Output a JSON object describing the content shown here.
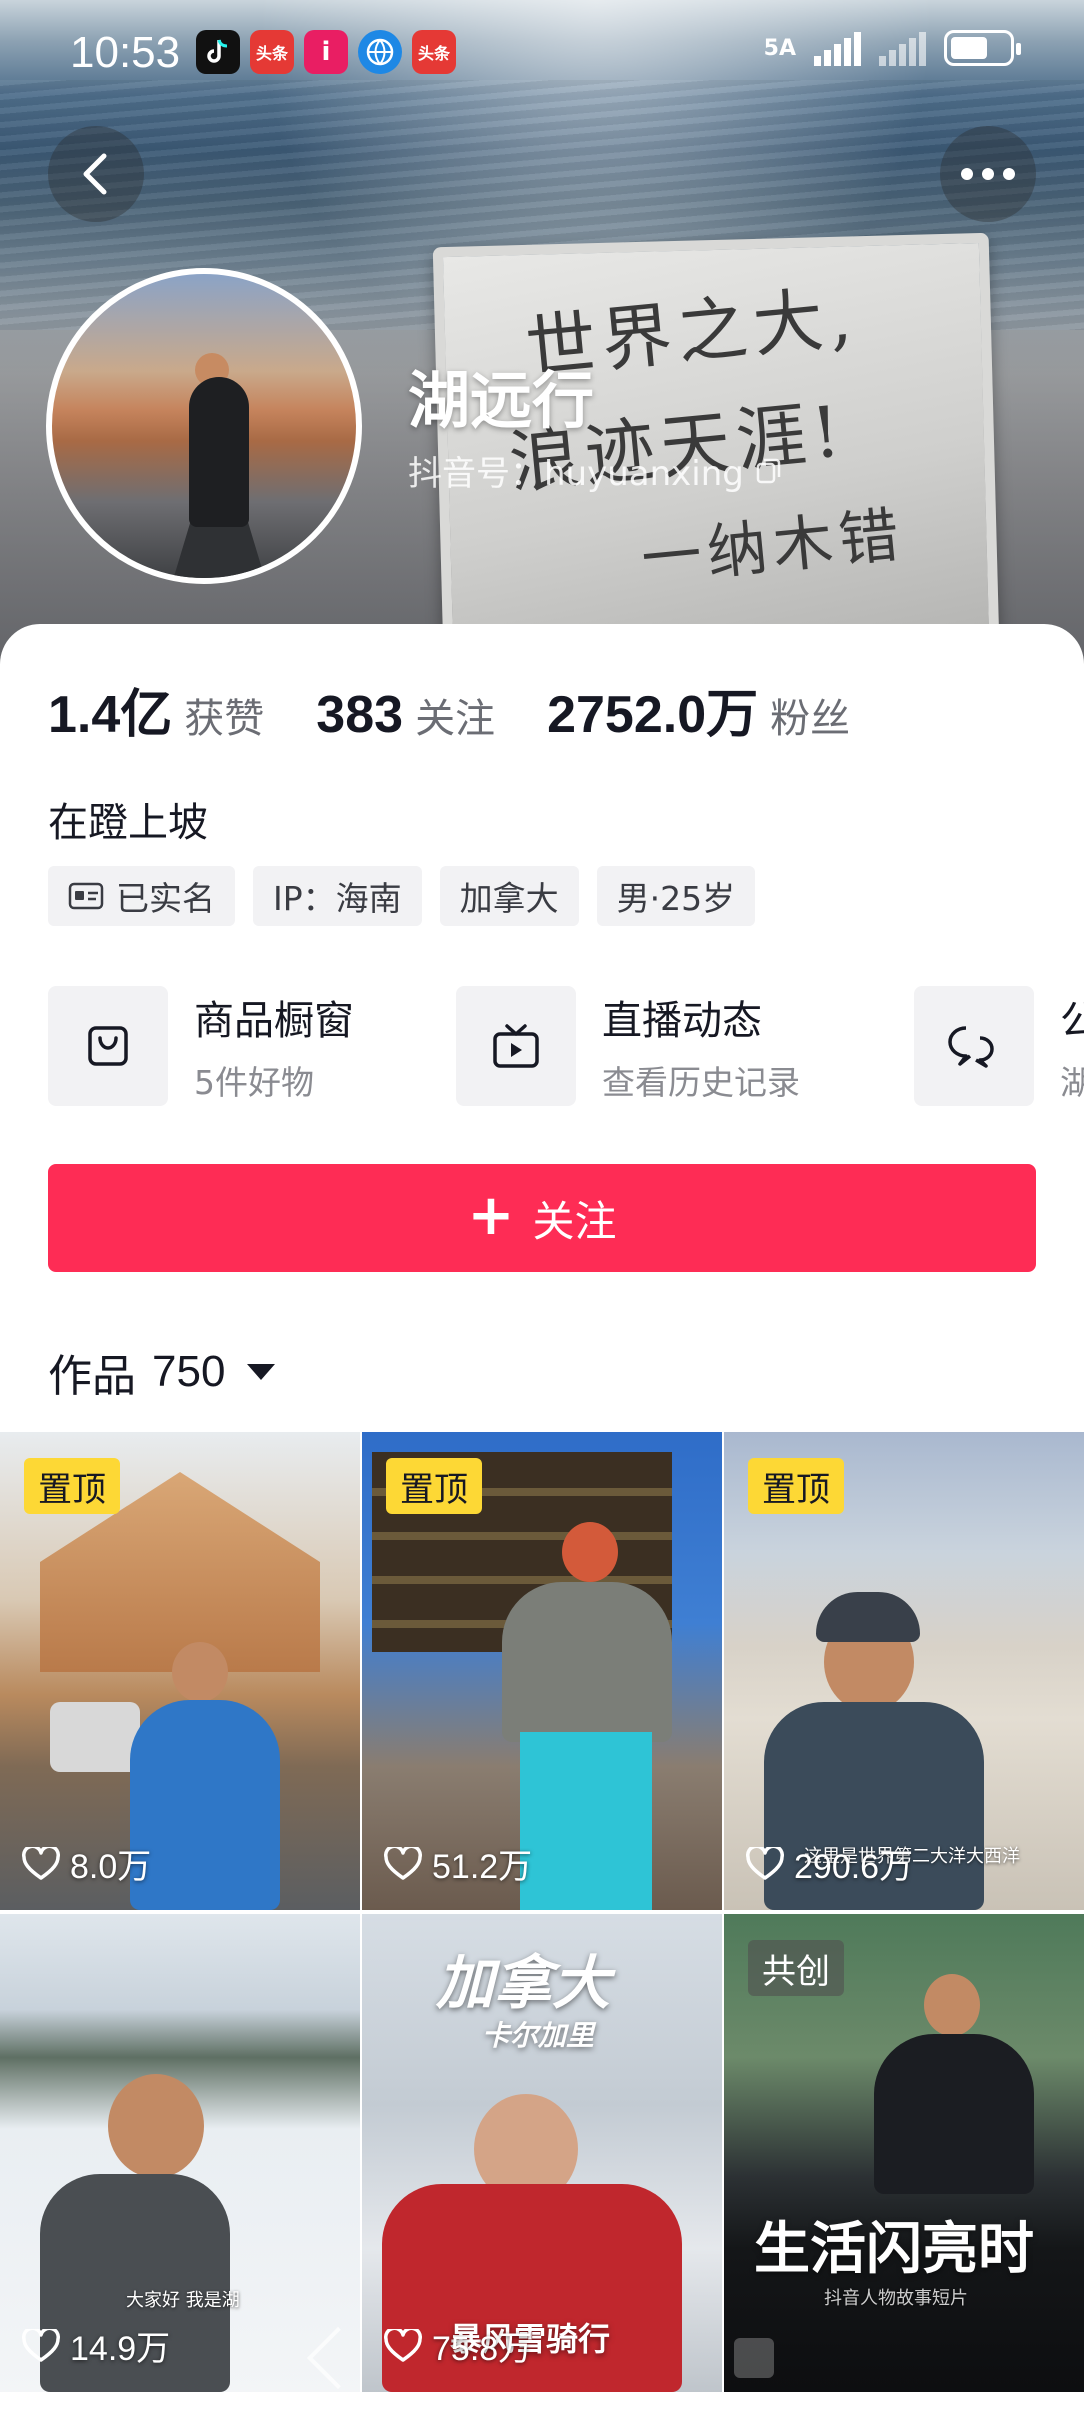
{
  "status_bar": {
    "time": "10:53",
    "network": "5A",
    "apps": [
      {
        "name": "tiktok-icon",
        "label": "",
        "color": "#111111"
      },
      {
        "name": "toutiao-icon",
        "label": "头条",
        "color": "#e53935"
      },
      {
        "name": "i-app-icon",
        "label": "i",
        "color": "#e91e63"
      },
      {
        "name": "browser-icon",
        "label": "",
        "color": "#1e88e5"
      },
      {
        "name": "toutiao-icon-2",
        "label": "头条",
        "color": "#e53935"
      }
    ]
  },
  "cover": {
    "whiteboard_lines": [
      "世界之大,",
      "浪迹天涯!",
      "一纳木错"
    ]
  },
  "profile": {
    "name": "湖远行",
    "id_label": "抖音号：huyuanxing"
  },
  "stats": [
    {
      "value": "1.4亿",
      "label": "获赞"
    },
    {
      "value": "383",
      "label": "关注"
    },
    {
      "value": "2752.0万",
      "label": "粉丝"
    }
  ],
  "bio": "在蹬上坡",
  "tags": [
    "已实名",
    "IP：海南",
    "加拿大",
    "男·25岁"
  ],
  "features": [
    {
      "title": "商品橱窗",
      "subtitle": "5件好物",
      "icon": "bag-icon"
    },
    {
      "title": "直播动态",
      "subtitle": "查看历史记录",
      "icon": "tv-icon"
    },
    {
      "title": "公",
      "subtitle": "湖",
      "icon": "chat-icon"
    }
  ],
  "follow_button": "关注",
  "works": {
    "label": "作品",
    "count": "750"
  },
  "videos": [
    {
      "badge": "置顶",
      "likes": "8.0万",
      "caption": ""
    },
    {
      "badge": "置顶",
      "likes": "51.2万",
      "caption": ""
    },
    {
      "badge": "置顶",
      "likes": "290.6万",
      "caption": "这里是世界第二大洋大西洋"
    },
    {
      "badge": "",
      "likes": "14.9万",
      "caption": "大家好 我是湖"
    },
    {
      "badge": "",
      "likes": "75.8万",
      "caption": "暴风雪骑行",
      "title": "加拿大",
      "subtitle": "卡尔加里"
    },
    {
      "badge": "共创",
      "likes": "",
      "caption": "抖音人物故事短片",
      "title": "生活闪亮时"
    }
  ],
  "colors": {
    "accent": "#fe2c55",
    "pin_badge": "#fdd835"
  }
}
